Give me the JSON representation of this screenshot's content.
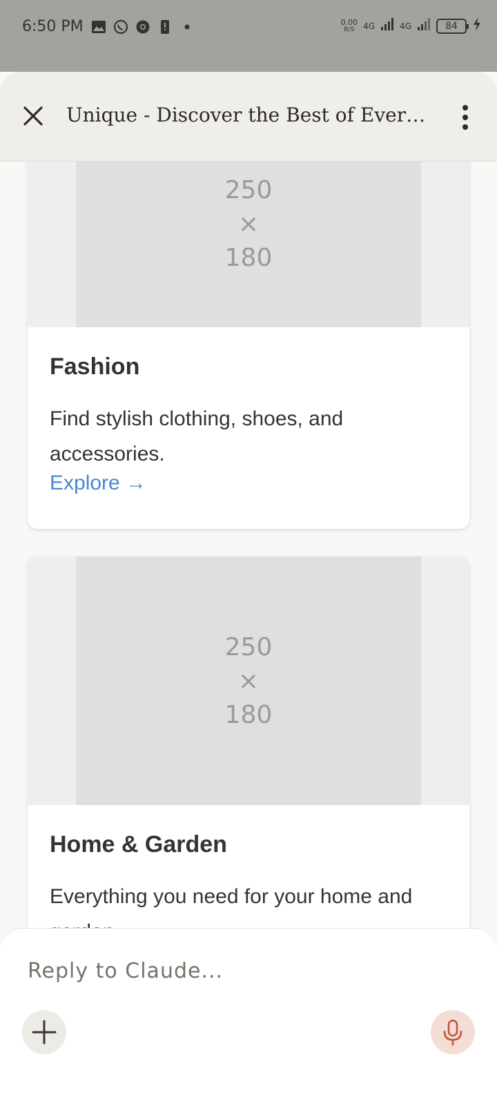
{
  "status_bar": {
    "time": "6:50 PM",
    "net_speed_value": "0.00",
    "net_speed_unit": "B/S",
    "sim1_label": "4G",
    "sim2_label": "4G",
    "battery": "84"
  },
  "header": {
    "title": "Unique - Discover the Best of Every..."
  },
  "cards": [
    {
      "image_line1": "250",
      "image_line2": "×",
      "image_line3": "180",
      "title": "Fashion",
      "description": "Find stylish clothing, shoes, and accessories.",
      "link": "Explore →"
    },
    {
      "image_line1": "250",
      "image_line2": "×",
      "image_line3": "180",
      "title": "Home & Garden",
      "description": "Everything you need for your home and garden."
    }
  ],
  "composer": {
    "placeholder": "Reply to Claude..."
  },
  "colors": {
    "link": "#4a85d6",
    "mic_accent": "#c0563a",
    "header_bg": "#f0eee8"
  }
}
